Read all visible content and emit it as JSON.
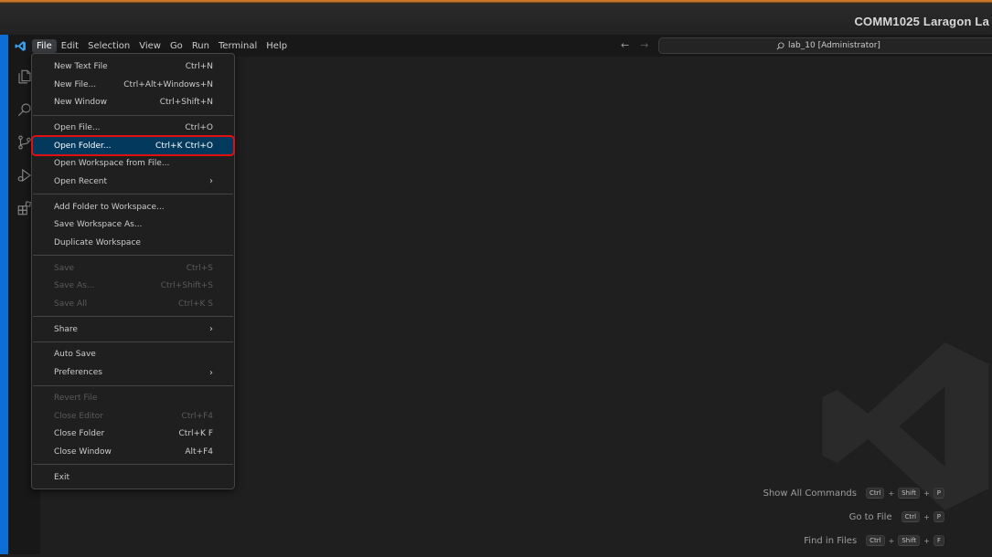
{
  "banner": {
    "title": "COMM1025  Laragon La"
  },
  "menubar": {
    "items": [
      "File",
      "Edit",
      "Selection",
      "View",
      "Go",
      "Run",
      "Terminal",
      "Help"
    ],
    "active": "File"
  },
  "nav": {
    "back": "←",
    "forward": "→"
  },
  "command_center": {
    "text": "lab_10 [Administrator]"
  },
  "activity_bar": {
    "icons": [
      "explorer-icon",
      "search-icon",
      "source-control-icon",
      "run-debug-icon",
      "extensions-icon"
    ]
  },
  "file_menu": {
    "groups": [
      [
        {
          "label": "New Text File",
          "shortcut": "Ctrl+N"
        },
        {
          "label": "New File...",
          "shortcut": "Ctrl+Alt+Windows+N"
        },
        {
          "label": "New Window",
          "shortcut": "Ctrl+Shift+N"
        }
      ],
      [
        {
          "label": "Open File...",
          "shortcut": "Ctrl+O"
        },
        {
          "label": "Open Folder...",
          "shortcut": "Ctrl+K Ctrl+O",
          "highlight": true
        },
        {
          "label": "Open Workspace from File...",
          "shortcut": ""
        },
        {
          "label": "Open Recent",
          "shortcut": "",
          "submenu": true
        }
      ],
      [
        {
          "label": "Add Folder to Workspace...",
          "shortcut": ""
        },
        {
          "label": "Save Workspace As...",
          "shortcut": ""
        },
        {
          "label": "Duplicate Workspace",
          "shortcut": ""
        }
      ],
      [
        {
          "label": "Save",
          "shortcut": "Ctrl+S",
          "disabled": true
        },
        {
          "label": "Save As...",
          "shortcut": "Ctrl+Shift+S",
          "disabled": true
        },
        {
          "label": "Save All",
          "shortcut": "Ctrl+K S",
          "disabled": true
        }
      ],
      [
        {
          "label": "Share",
          "shortcut": "",
          "submenu": true
        }
      ],
      [
        {
          "label": "Auto Save",
          "shortcut": ""
        },
        {
          "label": "Preferences",
          "shortcut": "",
          "submenu": true
        }
      ],
      [
        {
          "label": "Revert File",
          "shortcut": "",
          "disabled": true
        },
        {
          "label": "Close Editor",
          "shortcut": "Ctrl+F4",
          "disabled": true
        },
        {
          "label": "Close Folder",
          "shortcut": "Ctrl+K F"
        },
        {
          "label": "Close Window",
          "shortcut": "Alt+F4"
        }
      ],
      [
        {
          "label": "Exit",
          "shortcut": ""
        }
      ]
    ]
  },
  "editor_hints": [
    {
      "label": "Show All Commands",
      "keys": [
        "Ctrl",
        "Shift",
        "P"
      ]
    },
    {
      "label": "Go to File",
      "keys": [
        "Ctrl",
        "P"
      ]
    },
    {
      "label": "Find in Files",
      "keys": [
        "Ctrl",
        "Shift",
        "F"
      ]
    }
  ],
  "colors": {
    "accent_blue": "#0b6fd6",
    "highlight_bg": "#04395e",
    "highlight_border": "#e01010"
  }
}
